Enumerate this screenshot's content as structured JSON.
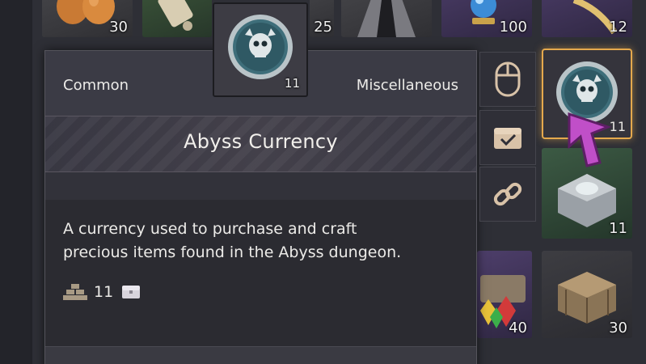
{
  "top_row": [
    {
      "icon": "egg-icon",
      "quantity": "30"
    },
    {
      "icon": "scroll-icon",
      "quantity": ""
    },
    {
      "icon": "material-icon",
      "quantity": "25"
    },
    {
      "icon": "hooded-figure-icon",
      "quantity": ""
    },
    {
      "icon": "crystal-orb-icon",
      "quantity": "100"
    },
    {
      "icon": "feather-icon",
      "quantity": "12"
    }
  ],
  "dragged_item": {
    "icon": "abyss-skull-coin-icon",
    "quantity": "11"
  },
  "tooltip": {
    "rarity": "Common",
    "category": "Miscellaneous",
    "name": "Abyss Currency",
    "description_line1": "A currency used to purchase and craft",
    "description_line2": "precious items found in the Abyss dungeon.",
    "stack_value": "11"
  },
  "side_actions": [
    {
      "icon": "mouse-icon"
    },
    {
      "icon": "chest-check-icon"
    },
    {
      "icon": "link-icon"
    }
  ],
  "right_column": [
    {
      "icon": "abyss-skull-coin-icon",
      "quantity": "11",
      "selected": true
    },
    {
      "icon": "silver-chest-icon",
      "quantity": "11"
    },
    {
      "icon": "gem-chest-icon",
      "quantity": "40"
    },
    {
      "icon": "wooden-crate-icon",
      "quantity": "30"
    }
  ],
  "colors": {
    "highlight": "#e5a94d",
    "cursor": "#c04fc8",
    "text": "#ecebe8"
  }
}
